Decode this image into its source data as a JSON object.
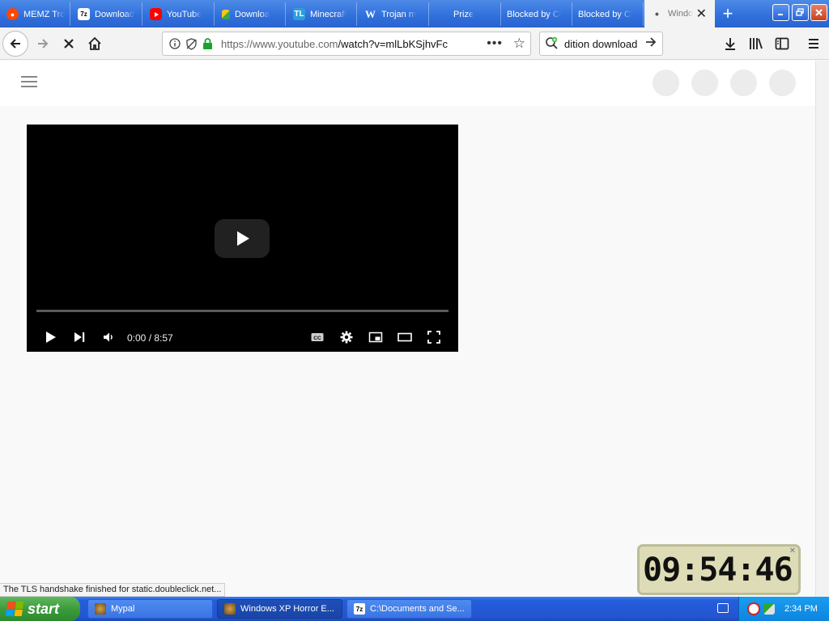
{
  "browser": {
    "tabs": [
      {
        "label": "MEMZ Tro",
        "icon": "reddit-icon",
        "icon_color": "#ff4500"
      },
      {
        "label": "Download",
        "icon": "7zip-icon",
        "icon_color": "#ffffff"
      },
      {
        "label": "YouTube",
        "icon": "youtube-icon",
        "icon_color": "#ff0000"
      },
      {
        "label": "Downloa",
        "icon": "google-drive-icon",
        "icon_color": "#f5c518"
      },
      {
        "label": "Minecraft",
        "icon": "tl-icon",
        "icon_color": "#2c9fd9"
      },
      {
        "label": "Trojan m",
        "icon": "wiki-icon",
        "icon_color": "#ffffff"
      },
      {
        "label": "Prize",
        "icon": "",
        "icon_color": ""
      },
      {
        "label": "Blocked by Cl",
        "icon": "",
        "icon_color": ""
      },
      {
        "label": "Blocked by Cl",
        "icon": "",
        "icon_color": ""
      },
      {
        "label": "Windo",
        "icon": "loading-dot-icon",
        "icon_color": "#555555",
        "active": true
      }
    ],
    "new_tab_label": "+",
    "url_host": "https://www.youtube.com",
    "url_path": "/watch?v=mlLbKSjhvFc",
    "search_text": "dition download",
    "status_text": "The TLS handshake finished for static.doubleclick.net..."
  },
  "player": {
    "time_text": "0:00 / 8:57",
    "progress": 0,
    "cc_label": "CC"
  },
  "clock_widget": {
    "digits": "09:54:46"
  },
  "taskbar": {
    "start_label": "start",
    "items": [
      {
        "label": "Mypal"
      },
      {
        "label": "Windows XP Horror E..."
      },
      {
        "label": "C:\\Documents and Se..."
      }
    ],
    "clock": "2:34 PM"
  },
  "colors": {
    "tab_strip": "#2f6fdc",
    "taskbar": "#245edb",
    "start_button": "#3c9c3c",
    "tray": "#0c85df"
  }
}
